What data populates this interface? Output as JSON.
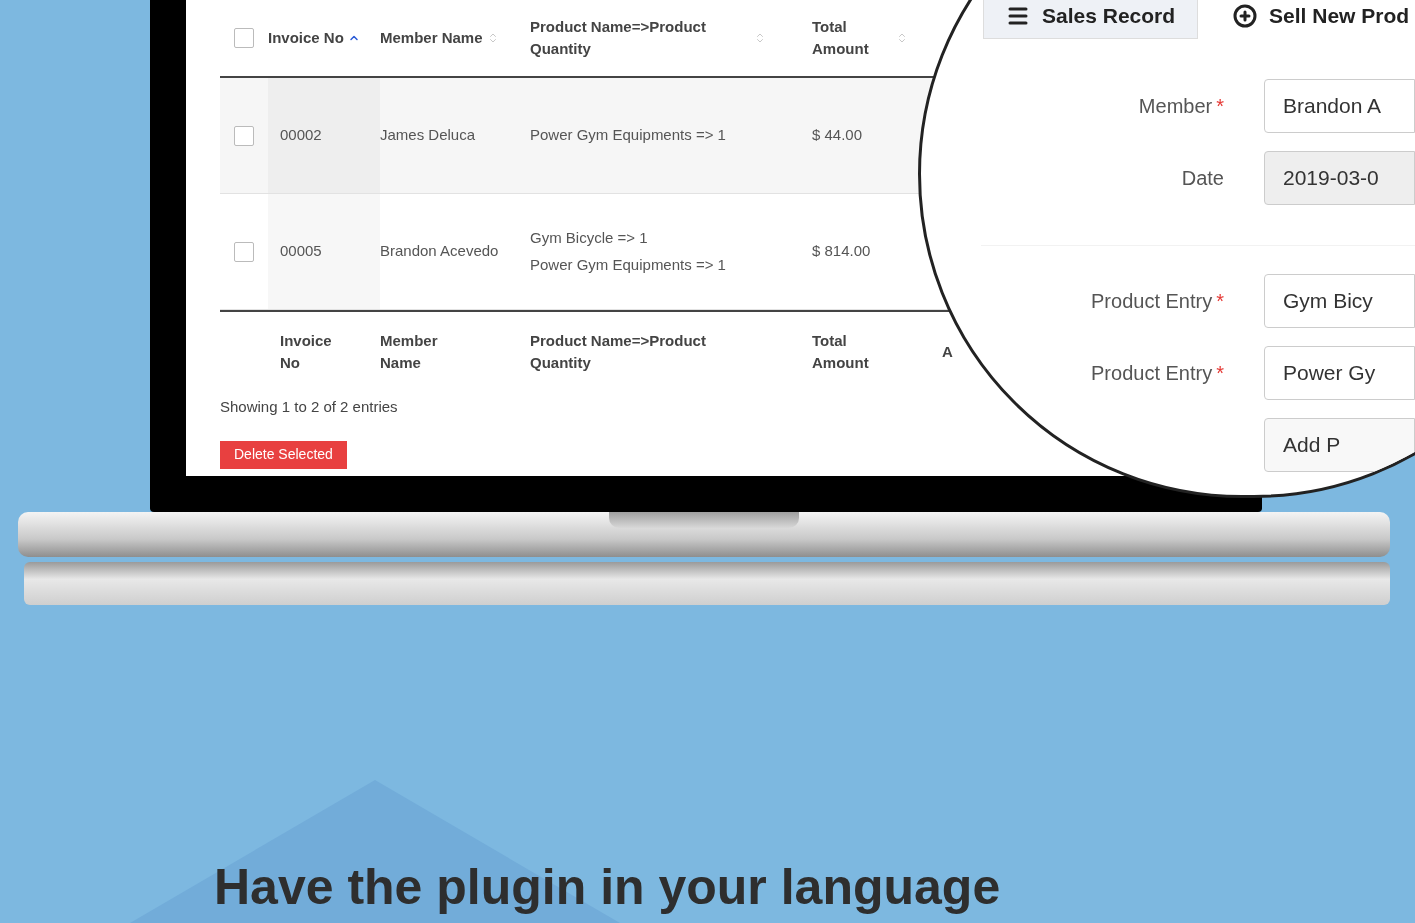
{
  "table": {
    "select_all_checked": false,
    "columns": [
      {
        "label": "Invoice No",
        "kind": "sorted_asc"
      },
      {
        "label": "Member Name",
        "kind": "sortable"
      },
      {
        "label": "Product Name=>Product Quantity",
        "kind": "sortable"
      },
      {
        "label": "Total Amount",
        "kind": "sortable"
      }
    ],
    "rows": [
      {
        "checked": false,
        "cells": [
          "00002",
          "James Deluca"
        ],
        "products": [
          "Power Gym Equipments => 1"
        ],
        "total": "$ 44.00"
      },
      {
        "checked": false,
        "cells": [
          "00005",
          "Brandon Acevedo"
        ],
        "products": [
          "Gym Bicycle => 1",
          "Power Gym Equipments => 1"
        ],
        "total": "$ 814.00"
      }
    ],
    "footer": [
      "Invoice No",
      "Member Name",
      "Product Name=>Product Quantity",
      "Total Amount",
      "A"
    ]
  },
  "entries_info": "Showing 1 to 2 of 2 entries",
  "delete_button": "Delete Selected",
  "magnifier": {
    "tabs": [
      {
        "label": "Sales Record",
        "selected": true
      },
      {
        "label": "Sell New Prod",
        "selected": false
      }
    ],
    "member_fields": [
      {
        "label": "Member",
        "required_mark": "*",
        "value": "Brandon A",
        "disabled": false
      },
      {
        "label": "Date",
        "value": "2019-03-0",
        "disabled": true
      }
    ],
    "product_fields": [
      {
        "label": "Product Entry",
        "required_mark": "*",
        "value": "Gym Bicy",
        "disabled": false
      },
      {
        "label": "Product Entry",
        "required_mark": "*",
        "value": "Power Gy",
        "disabled": false
      }
    ],
    "add_button": "Add P"
  },
  "heading": "Have the plugin in your language"
}
